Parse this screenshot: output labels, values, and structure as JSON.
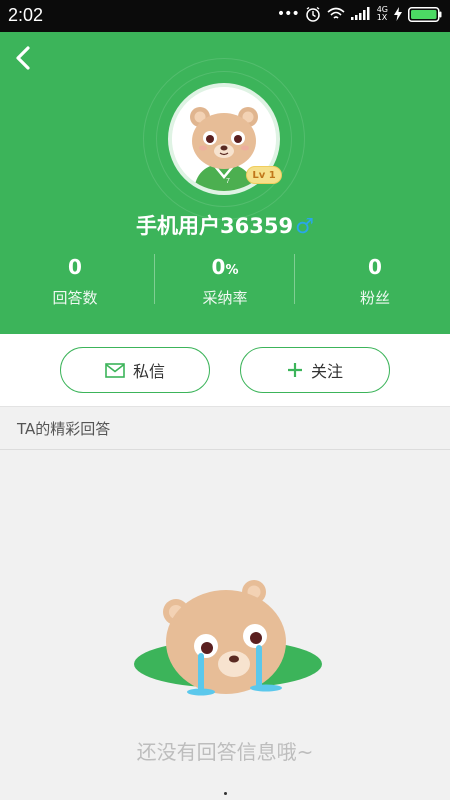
{
  "status_bar": {
    "time": "2:02",
    "network": [
      "4G",
      "1X"
    ]
  },
  "header": {
    "back_icon": "chevron-left-icon",
    "level_badge": "Lv 1",
    "username": "手机用户36359",
    "gender_symbol": "♂",
    "stats": [
      {
        "value": "0",
        "label": "回答数"
      },
      {
        "value": "0",
        "unit": "%",
        "label": "采纳率"
      },
      {
        "value": "0",
        "label": "粉丝"
      }
    ]
  },
  "actions": {
    "message_label": "私信",
    "follow_label": "关注"
  },
  "section": {
    "title": "TA的精彩回答"
  },
  "empty_state": {
    "text": "还没有回答信息哦~"
  },
  "colors": {
    "brand_green": "#3cb45a",
    "gender_blue": "#2aa6e8",
    "badge_yellow": "#f6e08a"
  }
}
